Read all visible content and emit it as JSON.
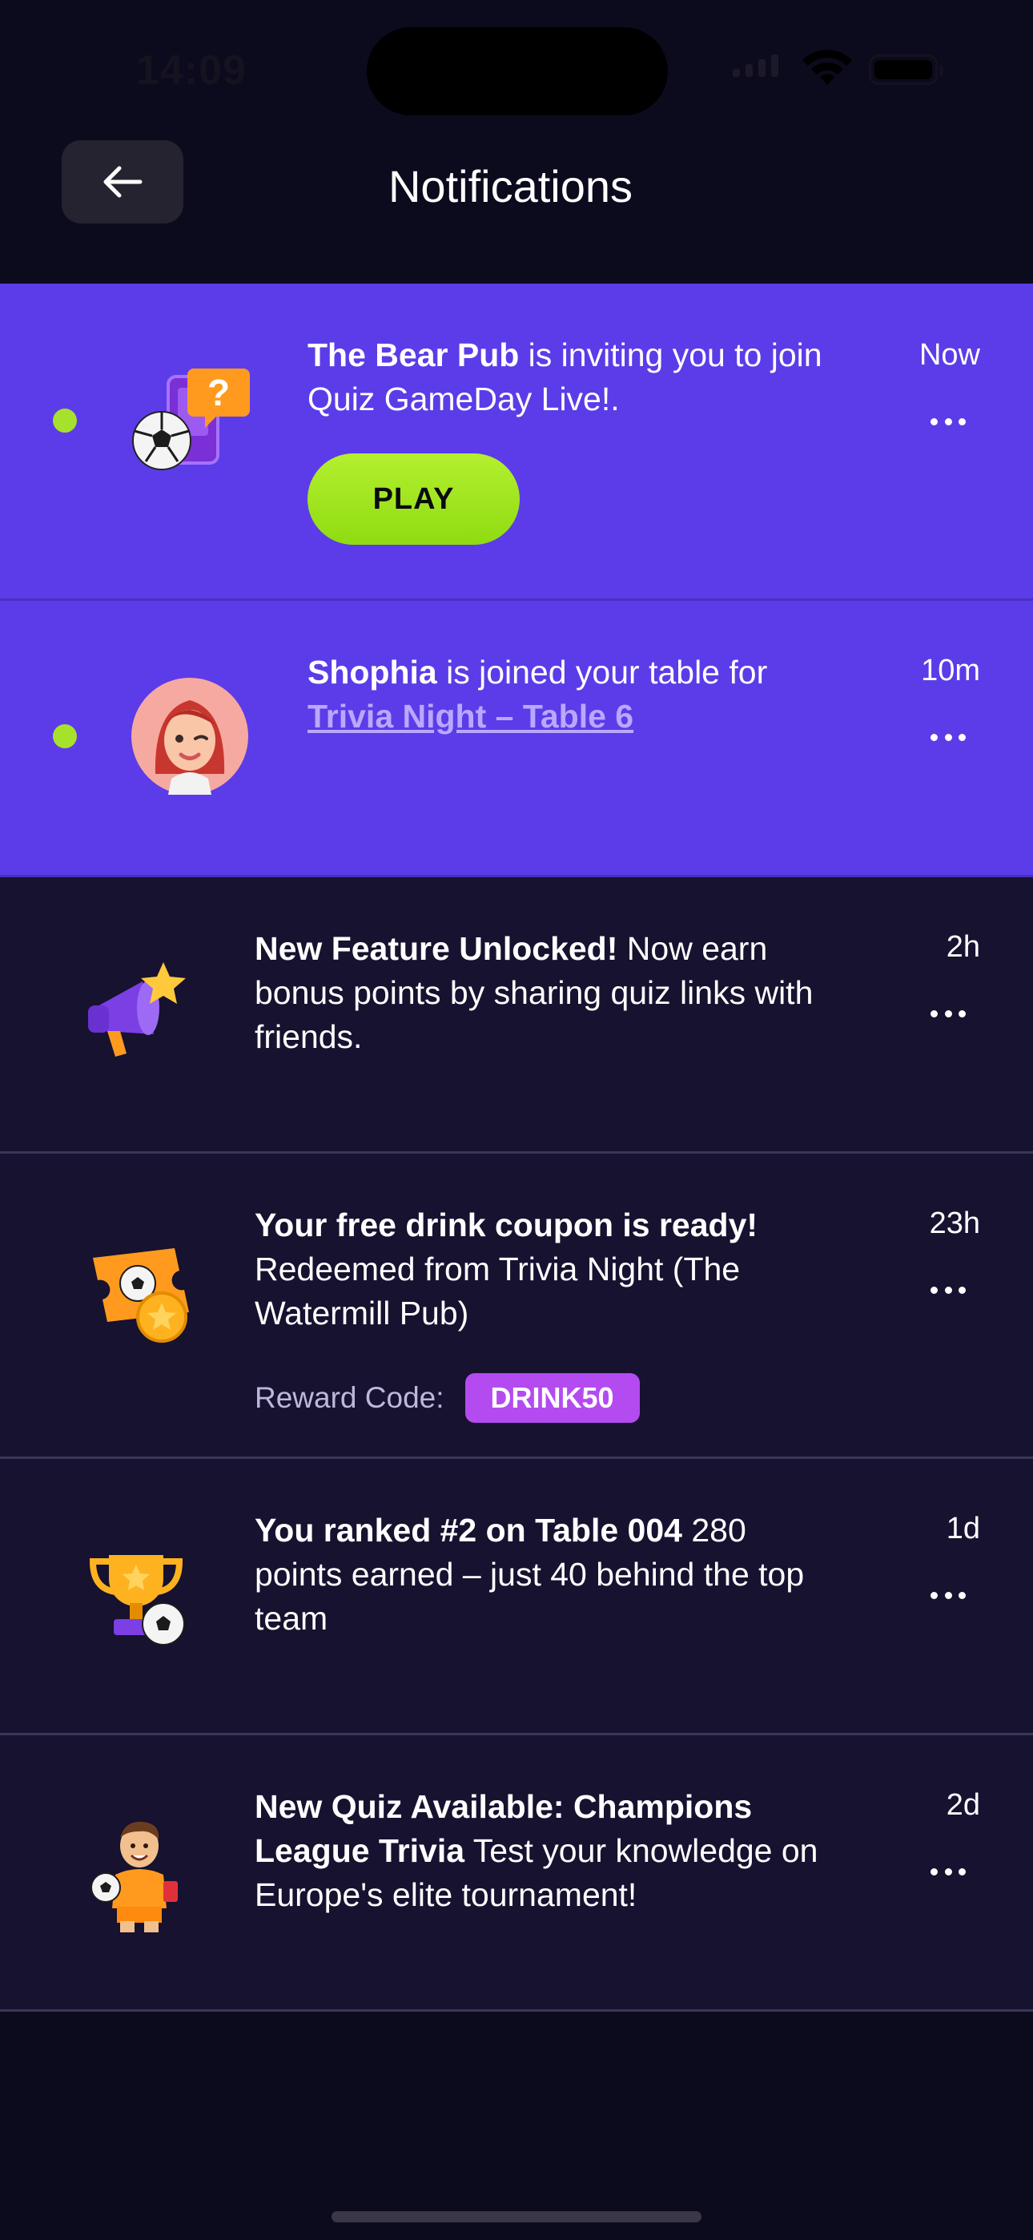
{
  "status_bar": {
    "time": "14:09"
  },
  "header": {
    "title": "Notifications",
    "back_icon": "arrow-left-icon"
  },
  "colors": {
    "unread_bg": "#5c3ce8",
    "read_bg": "#16122f",
    "page_bg": "#0c0a1d",
    "accent_green": "#a6e22c",
    "reward_badge": "#b44bf0"
  },
  "notifications": [
    {
      "unread": true,
      "icon": "soccer-question-icon",
      "bold": "The Bear Pub",
      "text": " is inviting you to join Quiz GameDay Live!.",
      "time": "Now",
      "action_label": "PLAY"
    },
    {
      "unread": true,
      "icon": "avatar-shophia",
      "bold": "Shophia",
      "text": " is joined your table for ",
      "link": "Trivia Night – Table 6",
      "time": "10m"
    },
    {
      "unread": false,
      "icon": "megaphone-star-icon",
      "bold": "New Feature Unlocked!",
      "text": " Now earn bonus points by sharing quiz links with friends.",
      "time": "2h"
    },
    {
      "unread": false,
      "icon": "ticket-coin-icon",
      "bold": "Your free drink coupon is ready!",
      "text": " Redeemed from Trivia Night (The Watermill Pub)",
      "time": "23h",
      "reward_label": "Reward Code:",
      "reward_code": "DRINK50"
    },
    {
      "unread": false,
      "icon": "trophy-ball-icon",
      "bold": "You ranked #2 on Table 004",
      "text": " 280 points earned – just 40 behind the top team",
      "time": "1d"
    },
    {
      "unread": false,
      "icon": "footballer-character-icon",
      "bold": "New Quiz Available: Champions League Trivia",
      "text": " Test your knowledge on Europe's elite tournament!",
      "time": "2d"
    }
  ]
}
